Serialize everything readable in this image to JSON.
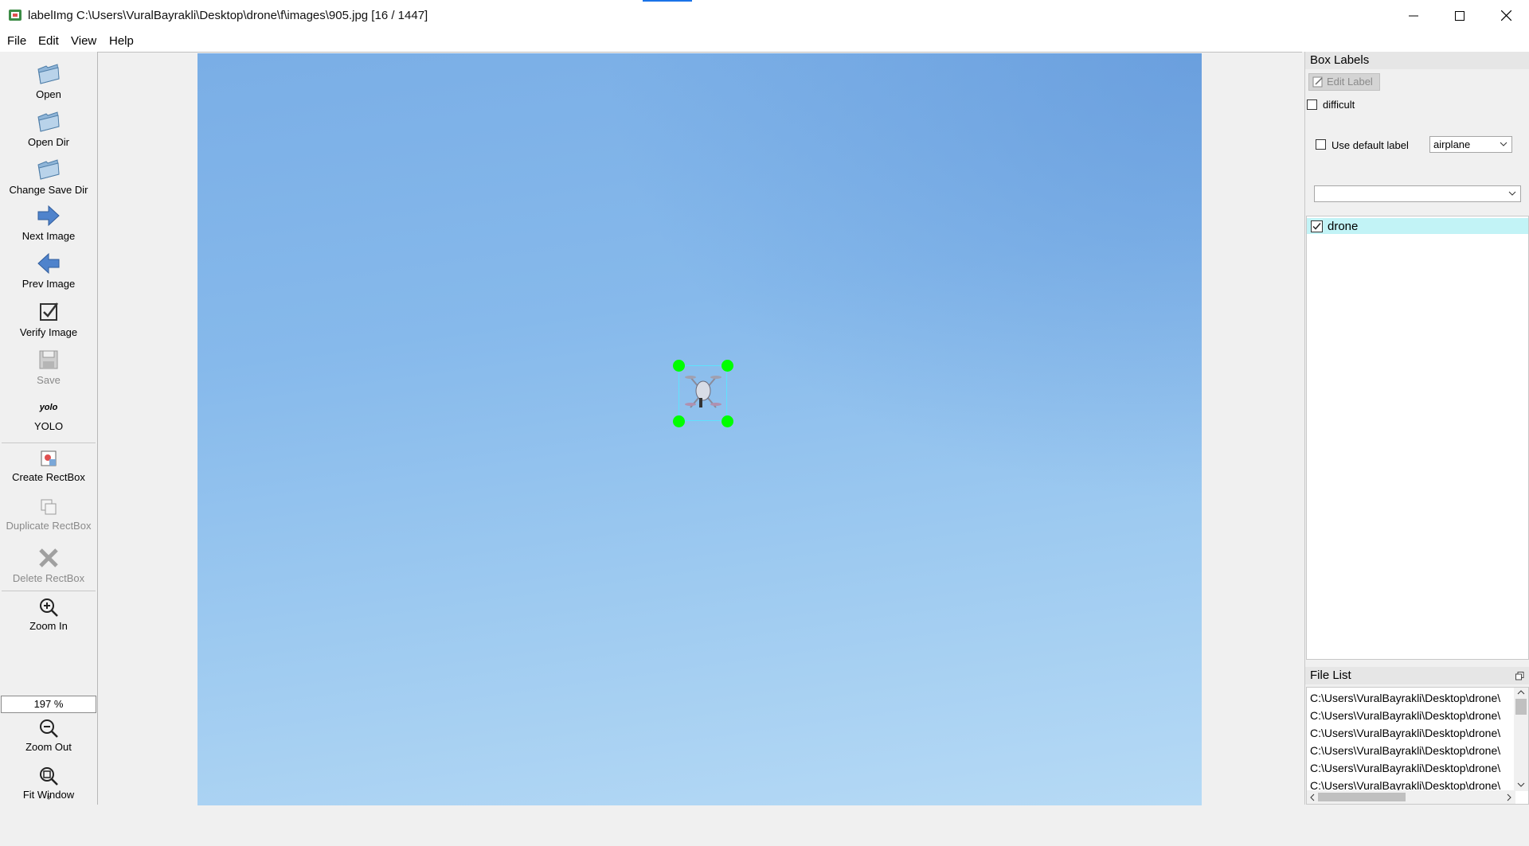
{
  "window": {
    "title": "labelImg C:\\Users\\VuralBayrakli\\Desktop\\drone\\f\\images\\905.jpg [16 / 1447]"
  },
  "menu": [
    "File",
    "Edit",
    "View",
    "Help"
  ],
  "toolbar": {
    "open": "Open",
    "open_dir": "Open Dir",
    "change_save_dir": "Change Save Dir",
    "next_image": "Next Image",
    "prev_image": "Prev Image",
    "verify_image": "Verify Image",
    "save": "Save",
    "format_icon_text": "yolo",
    "format": "YOLO",
    "create_rectbox": "Create RectBox",
    "duplicate_rectbox": "Duplicate RectBox",
    "delete_rectbox": "Delete RectBox",
    "zoom_in": "Zoom In",
    "zoom_value": "197 %",
    "zoom_out": "Zoom Out",
    "fit_window": "Fit Window",
    "more": "»"
  },
  "box_labels": {
    "title": "Box Labels",
    "edit_label": "Edit Label",
    "difficult": "difficult",
    "use_default_label": "Use default label",
    "default_label_value": "airplane",
    "filter_value": "",
    "labels": [
      {
        "name": "drone",
        "checked": true
      }
    ]
  },
  "file_list": {
    "title": "File List",
    "items": [
      "C:\\Users\\VuralBayrakli\\Desktop\\drone\\",
      "C:\\Users\\VuralBayrakli\\Desktop\\drone\\",
      "C:\\Users\\VuralBayrakli\\Desktop\\drone\\",
      "C:\\Users\\VuralBayrakli\\Desktop\\drone\\",
      "C:\\Users\\VuralBayrakli\\Desktop\\drone\\",
      "C:\\Users\\VuralBayrakli\\Desktop\\drone\\"
    ]
  },
  "colors": {
    "handle": "#00ff00",
    "selected_label_row": "#c2f3f6",
    "sky": "#86b9eb"
  }
}
